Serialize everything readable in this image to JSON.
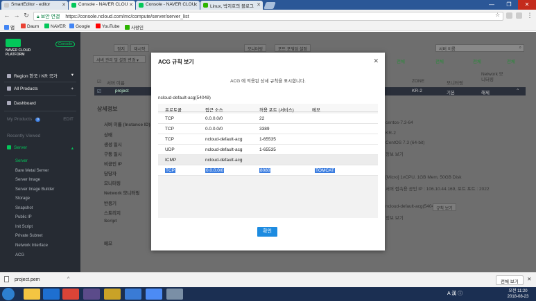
{
  "browser": {
    "tabs": [
      {
        "title": "SmartEditor - editor",
        "color": "#cccccc"
      },
      {
        "title": "Console - NAVER CLOU",
        "color": "#03c75a"
      },
      {
        "title": "Console - NAVER CLOU",
        "color": "#03c75a"
      },
      {
        "title": "Linux, 박지호의 블로그",
        "color": "#2db400"
      }
    ],
    "security_label": "보안 연결",
    "url": "https://console.ncloud.com/mc/compute/server/server_list",
    "bookmarks": [
      {
        "label": "앱",
        "color": "#4285f4"
      },
      {
        "label": "Daum",
        "color": "#ea4335"
      },
      {
        "label": "NAVER",
        "color": "#03c75a"
      },
      {
        "label": "Google",
        "color": "#4285f4"
      },
      {
        "label": "YouTube",
        "color": "#ff0000"
      },
      {
        "label": "사랑인",
        "color": "#2db400"
      }
    ]
  },
  "sidebar": {
    "logo_text": "NAVER CLOUD PLATFORM",
    "console_badge": "Console",
    "region": "Region 한국 / KR 국가",
    "all_products": "All Products",
    "dashboard": "Dashboard",
    "my_products": "My Products",
    "my_products_count": "0",
    "edit": "EDIT",
    "recently_viewed": "Recently Viewed",
    "server_group": "Server",
    "items": [
      "Server",
      "Bare Metal Server",
      "Server Image",
      "Server Image Builder",
      "Storage",
      "Snapshot",
      "Public IP",
      "Init Script",
      "Private Subnet",
      "Network Interface",
      "ACG"
    ]
  },
  "background": {
    "buttons": [
      "정지",
      "재시작",
      "모니터링",
      "포트 포워딩 설정"
    ],
    "filter_button": "서버 관리 및 설정 변경",
    "search_placeholder": "서버 이름",
    "filters": [
      "전체",
      "전체",
      "전체",
      "전체"
    ],
    "col_server_name": "서버 이름",
    "col_zone": "ZONE",
    "col_monitoring": "모니터링",
    "col_network": "Network 모니터링",
    "row_name": "project",
    "row_zone": "KR-2",
    "row_monitoring": "기본",
    "row_network": "해제",
    "detail_title": "상세정보",
    "detail_labels": [
      "서버 이름 (Instance ID)",
      "상태",
      "생성 일시",
      "구동 일시",
      "비공인 IP",
      "담당자",
      "모니터링",
      "Network 모니터링",
      "반응기",
      "스토리지",
      "Script",
      "메모"
    ],
    "detail_values": [
      "centos-7.3-64",
      "KR-2",
      "CentOS 7.3 (64-bit)",
      "정보 보기",
      "[Micro] 1vCPU, 1GB Mem, 50GB Disk",
      "서버 접속용 공인 IP : 106.10.44.169, 포트 포트 : 2022",
      "ncloud-default-acg(54048)",
      "규칙 보기",
      "정보 보기"
    ]
  },
  "modal": {
    "title": "ACG 규칙 보기",
    "description": "ACG 에 적용된 상세 규칙을 표시합니다.",
    "acg_name": "ncloud-default-acg(54048)",
    "headers": [
      "프로토콜",
      "접근 소스",
      "허용 포트 (서비스)",
      "메모"
    ],
    "rows": [
      {
        "protocol": "TCP",
        "source": "0.0.0.0/0",
        "port": "22",
        "memo": ""
      },
      {
        "protocol": "TCP",
        "source": "0.0.0.0/0",
        "port": "3389",
        "memo": ""
      },
      {
        "protocol": "TCP",
        "source": "ncloud-default-acg",
        "port": "1-65535",
        "memo": ""
      },
      {
        "protocol": "UDP",
        "source": "ncloud-default-acg",
        "port": "1-65535",
        "memo": ""
      },
      {
        "protocol": "ICMP",
        "source": "ncloud-default-acg",
        "port": "",
        "memo": ""
      },
      {
        "protocol": "TCP",
        "source": "0.0.0.0/0",
        "port": "8080",
        "memo": "TOMCAT"
      }
    ],
    "confirm": "확인"
  },
  "downloads": {
    "file": "project.pem",
    "show_all": "전체 보기"
  },
  "taskbar": {
    "tray": "A 漢 ⓘ",
    "time": "오전 11:20",
    "date": "2018-08-23"
  }
}
